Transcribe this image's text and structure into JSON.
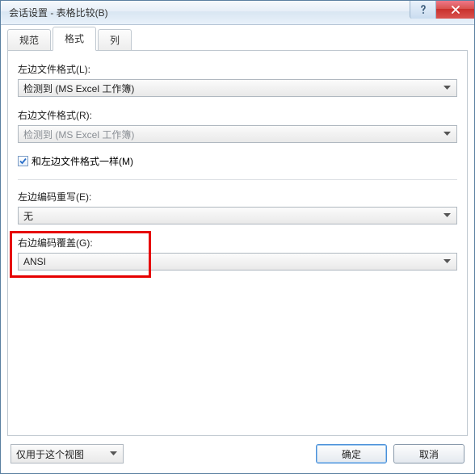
{
  "window": {
    "title": "会话设置 - 表格比较(B)"
  },
  "tabs": {
    "spec": "规范",
    "format": "格式",
    "columns": "列"
  },
  "form": {
    "left_format_label": "左边文件格式(L):",
    "left_format_value": "检测到 (MS Excel 工作簿)",
    "right_format_label": "右边文件格式(R):",
    "right_format_value": "检测到 (MS Excel 工作簿)",
    "same_as_left_label": "和左边文件格式一样(M)",
    "left_encoding_label": "左边编码重写(E):",
    "left_encoding_value": "无",
    "right_encoding_label": "右边编码覆盖(G):",
    "right_encoding_value": "ANSI"
  },
  "footer": {
    "scope_value": "仅用于这个视图",
    "ok": "确定",
    "cancel": "取消"
  }
}
